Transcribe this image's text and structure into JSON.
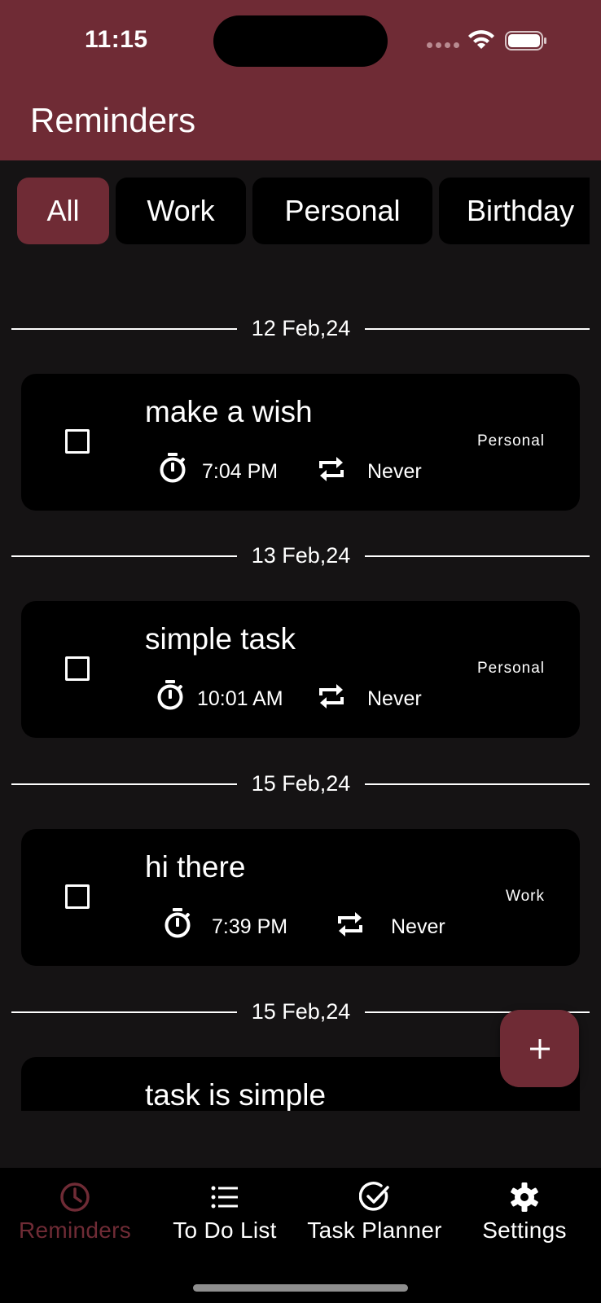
{
  "status_bar": {
    "time": "11:15"
  },
  "header": {
    "title": "Reminders"
  },
  "filters": [
    {
      "label": "All",
      "active": true
    },
    {
      "label": "Work",
      "active": false
    },
    {
      "label": "Personal",
      "active": false
    },
    {
      "label": "Birthday",
      "active": false
    }
  ],
  "groups": [
    {
      "date": "12 Feb,24",
      "reminder": {
        "title": "make a wish",
        "time": "7:04 PM",
        "repeat": "Never",
        "category": "Personal",
        "checked": false
      }
    },
    {
      "date": "13 Feb,24",
      "reminder": {
        "title": "simple task",
        "time": "10:01 AM",
        "repeat": "Never",
        "category": "Personal",
        "checked": false
      }
    },
    {
      "date": "15 Feb,24",
      "reminder": {
        "title": "hi there",
        "time": "7:39 PM",
        "repeat": "Never",
        "category": "Work",
        "checked": false
      }
    },
    {
      "date": "15 Feb,24",
      "reminder": {
        "title": "task is simple"
      }
    }
  ],
  "fab": {
    "icon": "plus-icon"
  },
  "bottom_nav": [
    {
      "label": "Reminders",
      "icon": "clock-icon",
      "active": true
    },
    {
      "label": "To Do List",
      "icon": "list-icon",
      "active": false
    },
    {
      "label": "Task Planner",
      "icon": "check-circle-icon",
      "active": false
    },
    {
      "label": "Settings",
      "icon": "gear-icon",
      "active": false
    }
  ],
  "colors": {
    "accent": "#6f2b35",
    "background": "#151314",
    "card": "#000000",
    "nav_active_text": "#6f2b35"
  }
}
